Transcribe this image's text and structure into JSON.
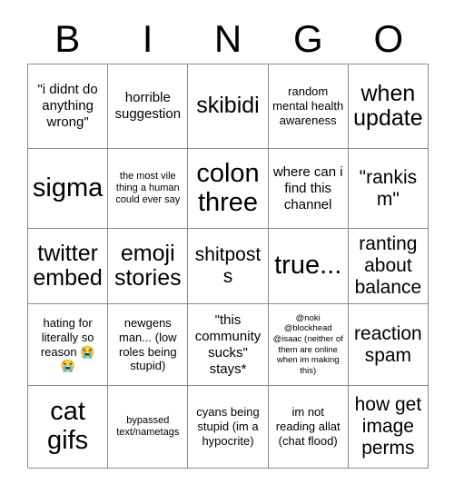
{
  "header": {
    "letters": [
      "B",
      "I",
      "N",
      "G",
      "O"
    ]
  },
  "grid": {
    "columns": 5,
    "rows": 5,
    "cells": [
      {
        "text": "\"i didnt do anything wrong\"",
        "size": "md"
      },
      {
        "text": "horrible suggestion",
        "size": "md"
      },
      {
        "text": "skibidi",
        "size": "xl"
      },
      {
        "text": "random mental health awareness",
        "size": "sm"
      },
      {
        "text": "when update",
        "size": "xl"
      },
      {
        "text": "sigma",
        "size": "xxl"
      },
      {
        "text": "the most vile thing a human could ever say",
        "size": "xs"
      },
      {
        "text": "colon three",
        "size": "xxl"
      },
      {
        "text": "where can i find this channel",
        "size": "md"
      },
      {
        "text": "\"rankism\"",
        "size": "lg"
      },
      {
        "text": "twitter embed",
        "size": "xl"
      },
      {
        "text": "emoji stories",
        "size": "xl"
      },
      {
        "text": "shitposts",
        "size": "lg"
      },
      {
        "text": "true...",
        "size": "xxl"
      },
      {
        "text": "ranting about balance",
        "size": "lg"
      },
      {
        "text": "hating for literally so reason 😭 😭",
        "size": "sm"
      },
      {
        "text": "newgens man... (low roles being stupid)",
        "size": "sm"
      },
      {
        "text": "\"this community sucks\" stays*",
        "size": "md"
      },
      {
        "text": "@noki @blockhead @isaac (neither of them are online when im making this)",
        "size": "xxs"
      },
      {
        "text": "reaction spam",
        "size": "lg"
      },
      {
        "text": "cat gifs",
        "size": "xxl"
      },
      {
        "text": "bypassed text/nametags",
        "size": "xs"
      },
      {
        "text": "cyans being stupid (im a hypocrite)",
        "size": "sm"
      },
      {
        "text": "im not reading allat (chat flood)",
        "size": "sm"
      },
      {
        "text": "how get image perms",
        "size": "lg"
      }
    ]
  },
  "colors": {
    "background": "#ffffff",
    "border": "#8a8a8a",
    "text": "#000000"
  }
}
